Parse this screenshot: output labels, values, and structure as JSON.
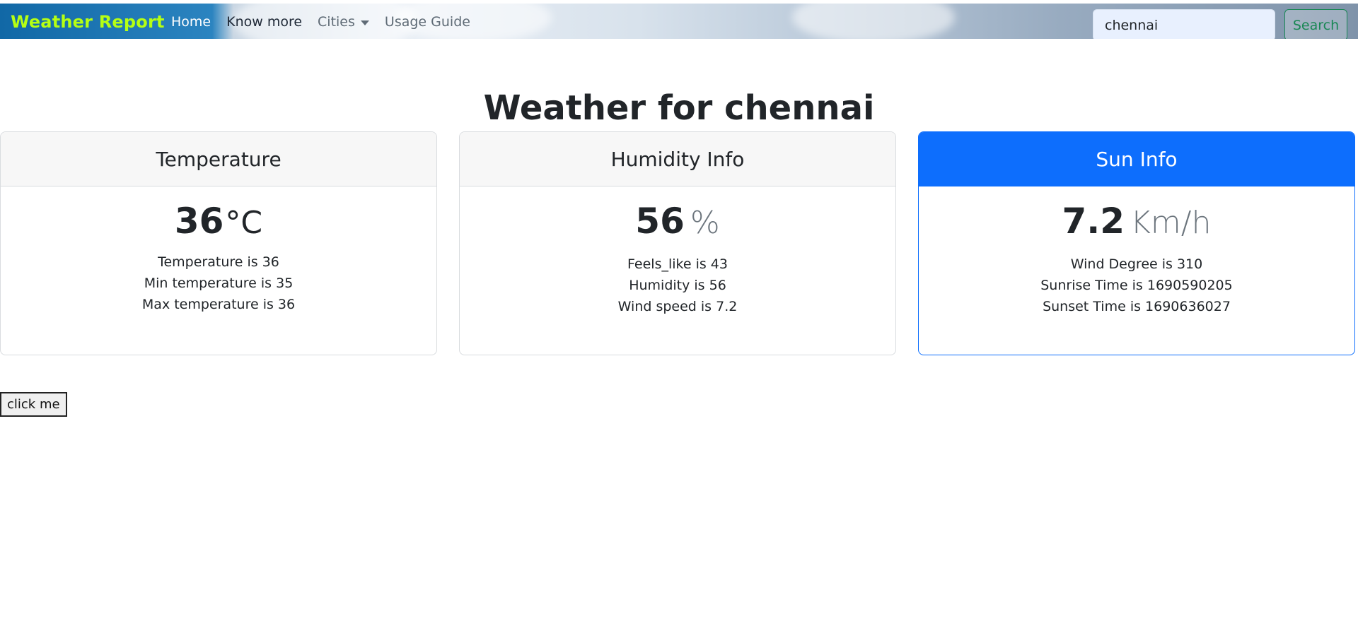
{
  "navbar": {
    "brand": "Weather Report",
    "links": {
      "home": "Home",
      "know_more": "Know more",
      "cities": "Cities",
      "usage_guide": "Usage Guide"
    },
    "search": {
      "value": "chennai",
      "button": "Search"
    }
  },
  "main": {
    "title": "Weather for chennai",
    "cards": [
      {
        "title": "Temperature",
        "value": "36",
        "unit": "°C",
        "lines": [
          "Temperature is 36",
          "Min temperature is 35",
          "Max temperature is 36"
        ]
      },
      {
        "title": "Humidity Info",
        "value": "56",
        "unit": "%",
        "lines": [
          "Feels_like is 43",
          "Humidity is 56",
          "Wind speed is 7.2"
        ]
      },
      {
        "title": "Sun Info",
        "value": "7.2",
        "unit": "Km/h",
        "lines": [
          "Wind Degree is 310",
          "Sunrise Time is 1690590205",
          "Sunset Time is 1690636027"
        ]
      }
    ],
    "click_button": "click me"
  },
  "colors": {
    "brand": "#b6ff13",
    "primary": "#0d6efd",
    "success": "#198754"
  }
}
